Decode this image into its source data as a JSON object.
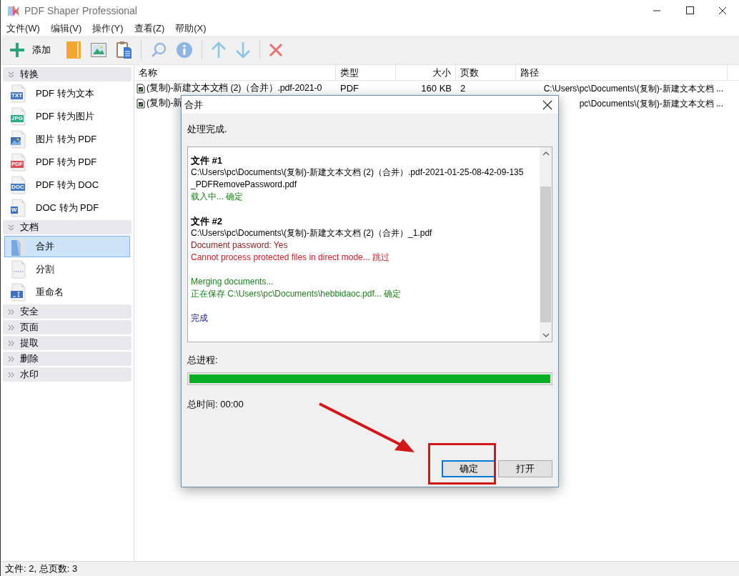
{
  "window": {
    "title": "PDF Shaper Professional"
  },
  "menu": [
    "文件(W)",
    "编辑(V)",
    "操作(Y)",
    "查看(Z)",
    "帮助(X)"
  ],
  "toolbar": {
    "add_label": "添加"
  },
  "sidebar": {
    "sections": [
      {
        "title": "转换",
        "expanded": true,
        "items": [
          {
            "label": "PDF 转为文本",
            "kind": "txt",
            "badge": "TXT",
            "selected": false
          },
          {
            "label": "PDF 转为图片",
            "kind": "jpg",
            "badge": "JPG",
            "selected": false
          },
          {
            "label": "图片 转为 PDF",
            "kind": "image",
            "selected": false
          },
          {
            "label": "PDF 转为 PDF",
            "kind": "pdf",
            "badge": "PDF",
            "selected": false
          },
          {
            "label": "PDF 转为 DOC",
            "kind": "doc",
            "badge": "DOC",
            "selected": false
          },
          {
            "label": "DOC 转为 PDF",
            "kind": "word",
            "badge": "W",
            "selected": false
          }
        ]
      },
      {
        "title": "文档",
        "expanded": true,
        "items": [
          {
            "label": "合并",
            "kind": "merge",
            "selected": true
          },
          {
            "label": "分割",
            "kind": "split",
            "selected": false
          },
          {
            "label": "重命名",
            "kind": "rename",
            "selected": false
          }
        ]
      },
      {
        "title": "安全",
        "expanded": false
      },
      {
        "title": "页面",
        "expanded": false
      },
      {
        "title": "提取",
        "expanded": false
      },
      {
        "title": "删除",
        "expanded": false
      },
      {
        "title": "水印",
        "expanded": false
      }
    ]
  },
  "table": {
    "columns": [
      "名称",
      "类型",
      "大小",
      "页数",
      "路径"
    ],
    "rows": [
      {
        "name": "(复制)-新建文本文档 (2)（合并）.pdf-2021-0",
        "type": "PDF",
        "size": "160 KB",
        "pages": "2",
        "path": "C:\\Users\\pc\\Documents\\(复制)-新建文本文档 ..."
      },
      {
        "name": "(复制)-新",
        "path": "pc\\Documents\\(复制)-新建文本文档 ..."
      }
    ]
  },
  "dialog": {
    "title": "合并",
    "status": "处理完成.",
    "log": [
      {
        "lines": [
          {
            "kind": "heading",
            "text": "文件 #1"
          },
          {
            "kind": "path",
            "text": "C:\\Users\\pc\\Documents\\(复制)-新建文本文档 (2)（合并）.pdf-2021-01-25-08-42-09-135 _PDFRemovePassword.pdf"
          },
          {
            "kind": "success",
            "text": "载入中... 确定"
          }
        ]
      },
      {
        "lines": [
          {
            "kind": "heading",
            "text": "文件 #2"
          },
          {
            "kind": "path",
            "text": "C:\\Users\\pc\\Documents\\(复制)-新建文本文档 (2)（合并）_1.pdf"
          },
          {
            "kind": "warning",
            "text": "Document password: Yes"
          },
          {
            "kind": "error",
            "text": "Cannot process protected files in direct mode... 跳过"
          }
        ]
      },
      {
        "lines": [
          {
            "kind": "success",
            "text": "Merging documents..."
          },
          {
            "kind": "success",
            "text": "正在保存 C:\\Users\\pc\\Documents\\hebbidaoc.pdf... 确定"
          }
        ]
      },
      {
        "lines": [
          {
            "kind": "done",
            "text": "完成"
          }
        ]
      }
    ],
    "progress_label": "总进程:",
    "progress": {
      "level": 1
    },
    "time_label": "总时间: 00:00",
    "buttons": [
      {
        "label": "确定",
        "default": true
      },
      {
        "label": "打开",
        "default": false
      }
    ]
  },
  "status_bar": "文件: 2, 总页数: 3"
}
